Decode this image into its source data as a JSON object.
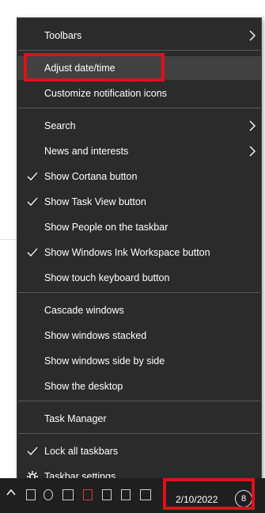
{
  "menu": {
    "items": [
      {
        "label": "Toolbars",
        "checked": false,
        "submenu": true
      },
      {
        "label": "Adjust date/time",
        "checked": false,
        "submenu": false
      },
      {
        "label": "Customize notification icons",
        "checked": false,
        "submenu": false
      },
      {
        "label": "Search",
        "checked": false,
        "submenu": true
      },
      {
        "label": "News and interests",
        "checked": false,
        "submenu": true
      },
      {
        "label": "Show Cortana button",
        "checked": true,
        "submenu": false
      },
      {
        "label": "Show Task View button",
        "checked": true,
        "submenu": false
      },
      {
        "label": "Show People on the taskbar",
        "checked": false,
        "submenu": false
      },
      {
        "label": "Show Windows Ink Workspace button",
        "checked": true,
        "submenu": false
      },
      {
        "label": "Show touch keyboard button",
        "checked": false,
        "submenu": false
      },
      {
        "label": "Cascade windows",
        "checked": false,
        "submenu": false
      },
      {
        "label": "Show windows stacked",
        "checked": false,
        "submenu": false
      },
      {
        "label": "Show windows side by side",
        "checked": false,
        "submenu": false
      },
      {
        "label": "Show the desktop",
        "checked": false,
        "submenu": false
      },
      {
        "label": "Task Manager",
        "checked": false,
        "submenu": false
      },
      {
        "label": "Lock all taskbars",
        "checked": true,
        "submenu": false
      },
      {
        "label": "Taskbar settings",
        "checked": false,
        "submenu": false,
        "icon": "gear-icon"
      }
    ]
  },
  "taskbar": {
    "date": "2/10/2022",
    "notification_count": "8"
  },
  "colors": {
    "menu_bg": "#2b2b2b",
    "hover_bg": "#414141",
    "highlight": "#e0101a",
    "taskbar_bg": "#1f1f1f"
  }
}
